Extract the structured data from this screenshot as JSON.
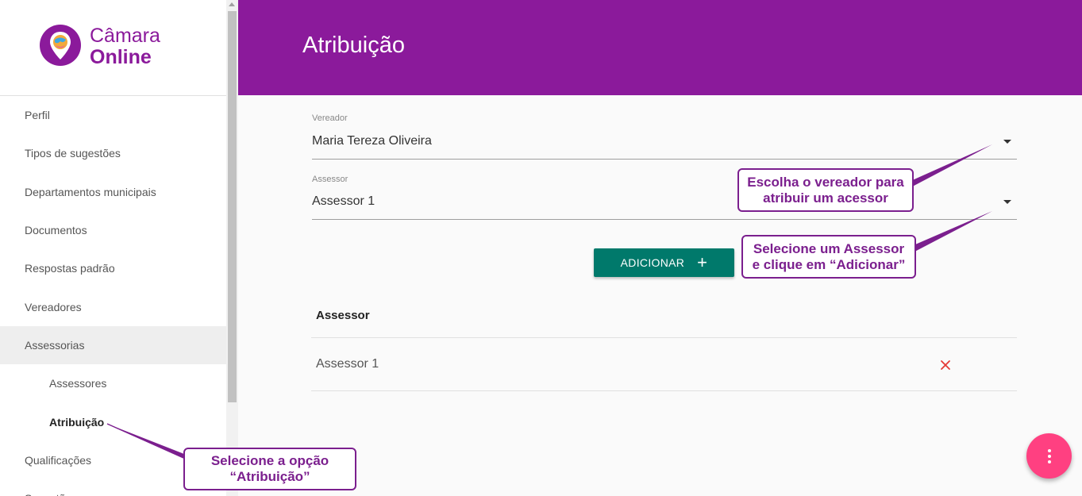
{
  "app": {
    "logo_line1": "Câmara",
    "logo_line2": "Online",
    "brand_color": "#8b1a9b"
  },
  "sidebar": {
    "items": [
      {
        "label": "Perfil"
      },
      {
        "label": "Tipos de sugestões"
      },
      {
        "label": "Departamentos municipais"
      },
      {
        "label": "Documentos"
      },
      {
        "label": "Respostas padrão"
      },
      {
        "label": "Vereadores"
      },
      {
        "label": "Assessorias"
      },
      {
        "label": "Assessores"
      },
      {
        "label": "Atribuição"
      },
      {
        "label": "Qualificações"
      },
      {
        "label": "Sugestões"
      }
    ]
  },
  "header": {
    "title": "Atribuição"
  },
  "form": {
    "vereador_label": "Vereador",
    "vereador_value": "Maria Tereza Oliveira",
    "assessor_label": "Assessor",
    "assessor_value": "Assessor 1",
    "add_button_label": "ADICIONAR",
    "add_icon": "plus-icon",
    "button_color": "#00796b"
  },
  "table": {
    "header": "Assessor",
    "rows": [
      {
        "name": "Assessor 1",
        "action_icon": "close-icon"
      }
    ]
  },
  "fab": {
    "icon": "more-vert-icon",
    "color": "#ff4081"
  },
  "annotations": {
    "callout1_line1": "Escolha o vereador para",
    "callout1_line2": "atribuir um acessor",
    "callout2_line1": "Selecione um Assessor",
    "callout2_line2": "e clique em “Adicionar”",
    "callout3_line1": "Selecione a opção",
    "callout3_line2": "“Atribuição”",
    "color": "#7b1f8e"
  }
}
